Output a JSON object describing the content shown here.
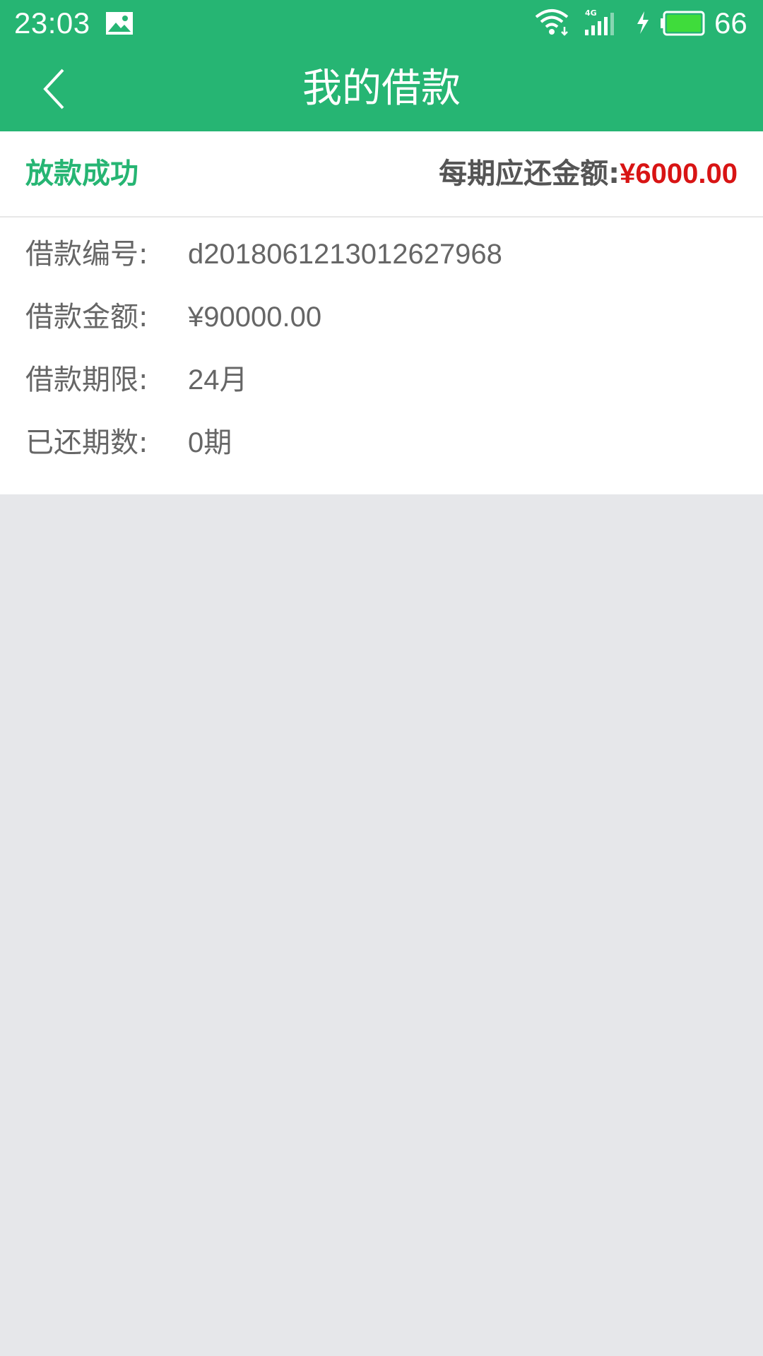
{
  "status_bar": {
    "time": "23:03",
    "battery_percent": "66",
    "network": "4G",
    "icons": [
      "image-notification-icon",
      "wifi-icon",
      "cellular-signal-icon",
      "charging-bolt-icon",
      "battery-icon"
    ]
  },
  "nav": {
    "title": "我的借款",
    "back_icon": "chevron-left-icon"
  },
  "loan": {
    "status": "放款成功",
    "repay_label": "每期应还金额:",
    "repay_amount": "¥6000.00",
    "details": [
      {
        "label": "借款编号:",
        "value": "d2018061213012627968"
      },
      {
        "label": "借款金额:",
        "value": "¥90000.00"
      },
      {
        "label": "借款期限:",
        "value": "24月"
      },
      {
        "label": "已还期数:",
        "value": "0期"
      }
    ]
  },
  "colors": {
    "brand_green": "#26b573",
    "amount_red": "#d81414",
    "text_gray": "#666666",
    "background": "#e6e7ea"
  }
}
